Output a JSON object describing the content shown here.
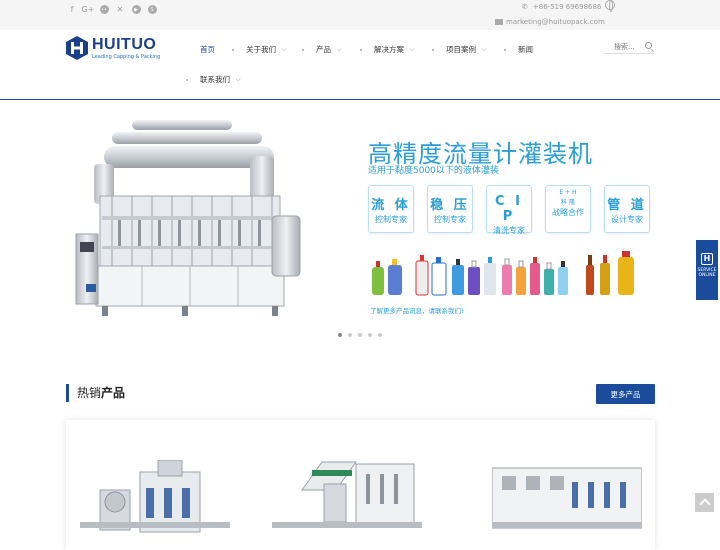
{
  "topbar": {
    "social_icons": [
      "facebook-icon",
      "google-plus-icon",
      "flickr-icon",
      "x-icon",
      "youtube-icon",
      "skype-icon"
    ],
    "phone": "+86-519 69698686",
    "email": "marketing@huituopack.com"
  },
  "logo": {
    "name": "HUITUO",
    "tagline": "Leading Capping & Packing"
  },
  "nav": {
    "items": [
      {
        "label": "首页",
        "active": true
      },
      {
        "label": "关于我们",
        "has_dropdown": true
      },
      {
        "label": "产品",
        "has_dropdown": true
      },
      {
        "label": "解决方案",
        "has_dropdown": true
      },
      {
        "label": "项目案例",
        "has_dropdown": true
      },
      {
        "label": "新闻"
      },
      {
        "label": "联系我们",
        "has_dropdown": true
      }
    ],
    "search_placeholder": "搜索..."
  },
  "banner": {
    "title": "高精度流量计灌装机",
    "subtitle": "适用于黏度5000以下的液体灌装",
    "features": [
      {
        "big": "流 体",
        "small": "控制专家"
      },
      {
        "big": "稳 压",
        "small": "控制专家"
      },
      {
        "big": "C I P",
        "small": "清洗专家"
      },
      {
        "big": "E + H",
        "tiny": "科 隆",
        "small": "战略合作"
      },
      {
        "big": "管 道",
        "small": "设计专家"
      }
    ],
    "link_text": "了解更多产品讯息，请联系我们!",
    "slides": 5,
    "active_slide": 0
  },
  "hot_products": {
    "title_prefix": "热销",
    "title_bold": "产品",
    "more_button": "更多产品"
  },
  "service": {
    "line1": "SERVICE",
    "line2": "ONLINE"
  },
  "colors": {
    "brand_blue": "#1b4c9c",
    "banner_accent": "#2a9fd6"
  }
}
